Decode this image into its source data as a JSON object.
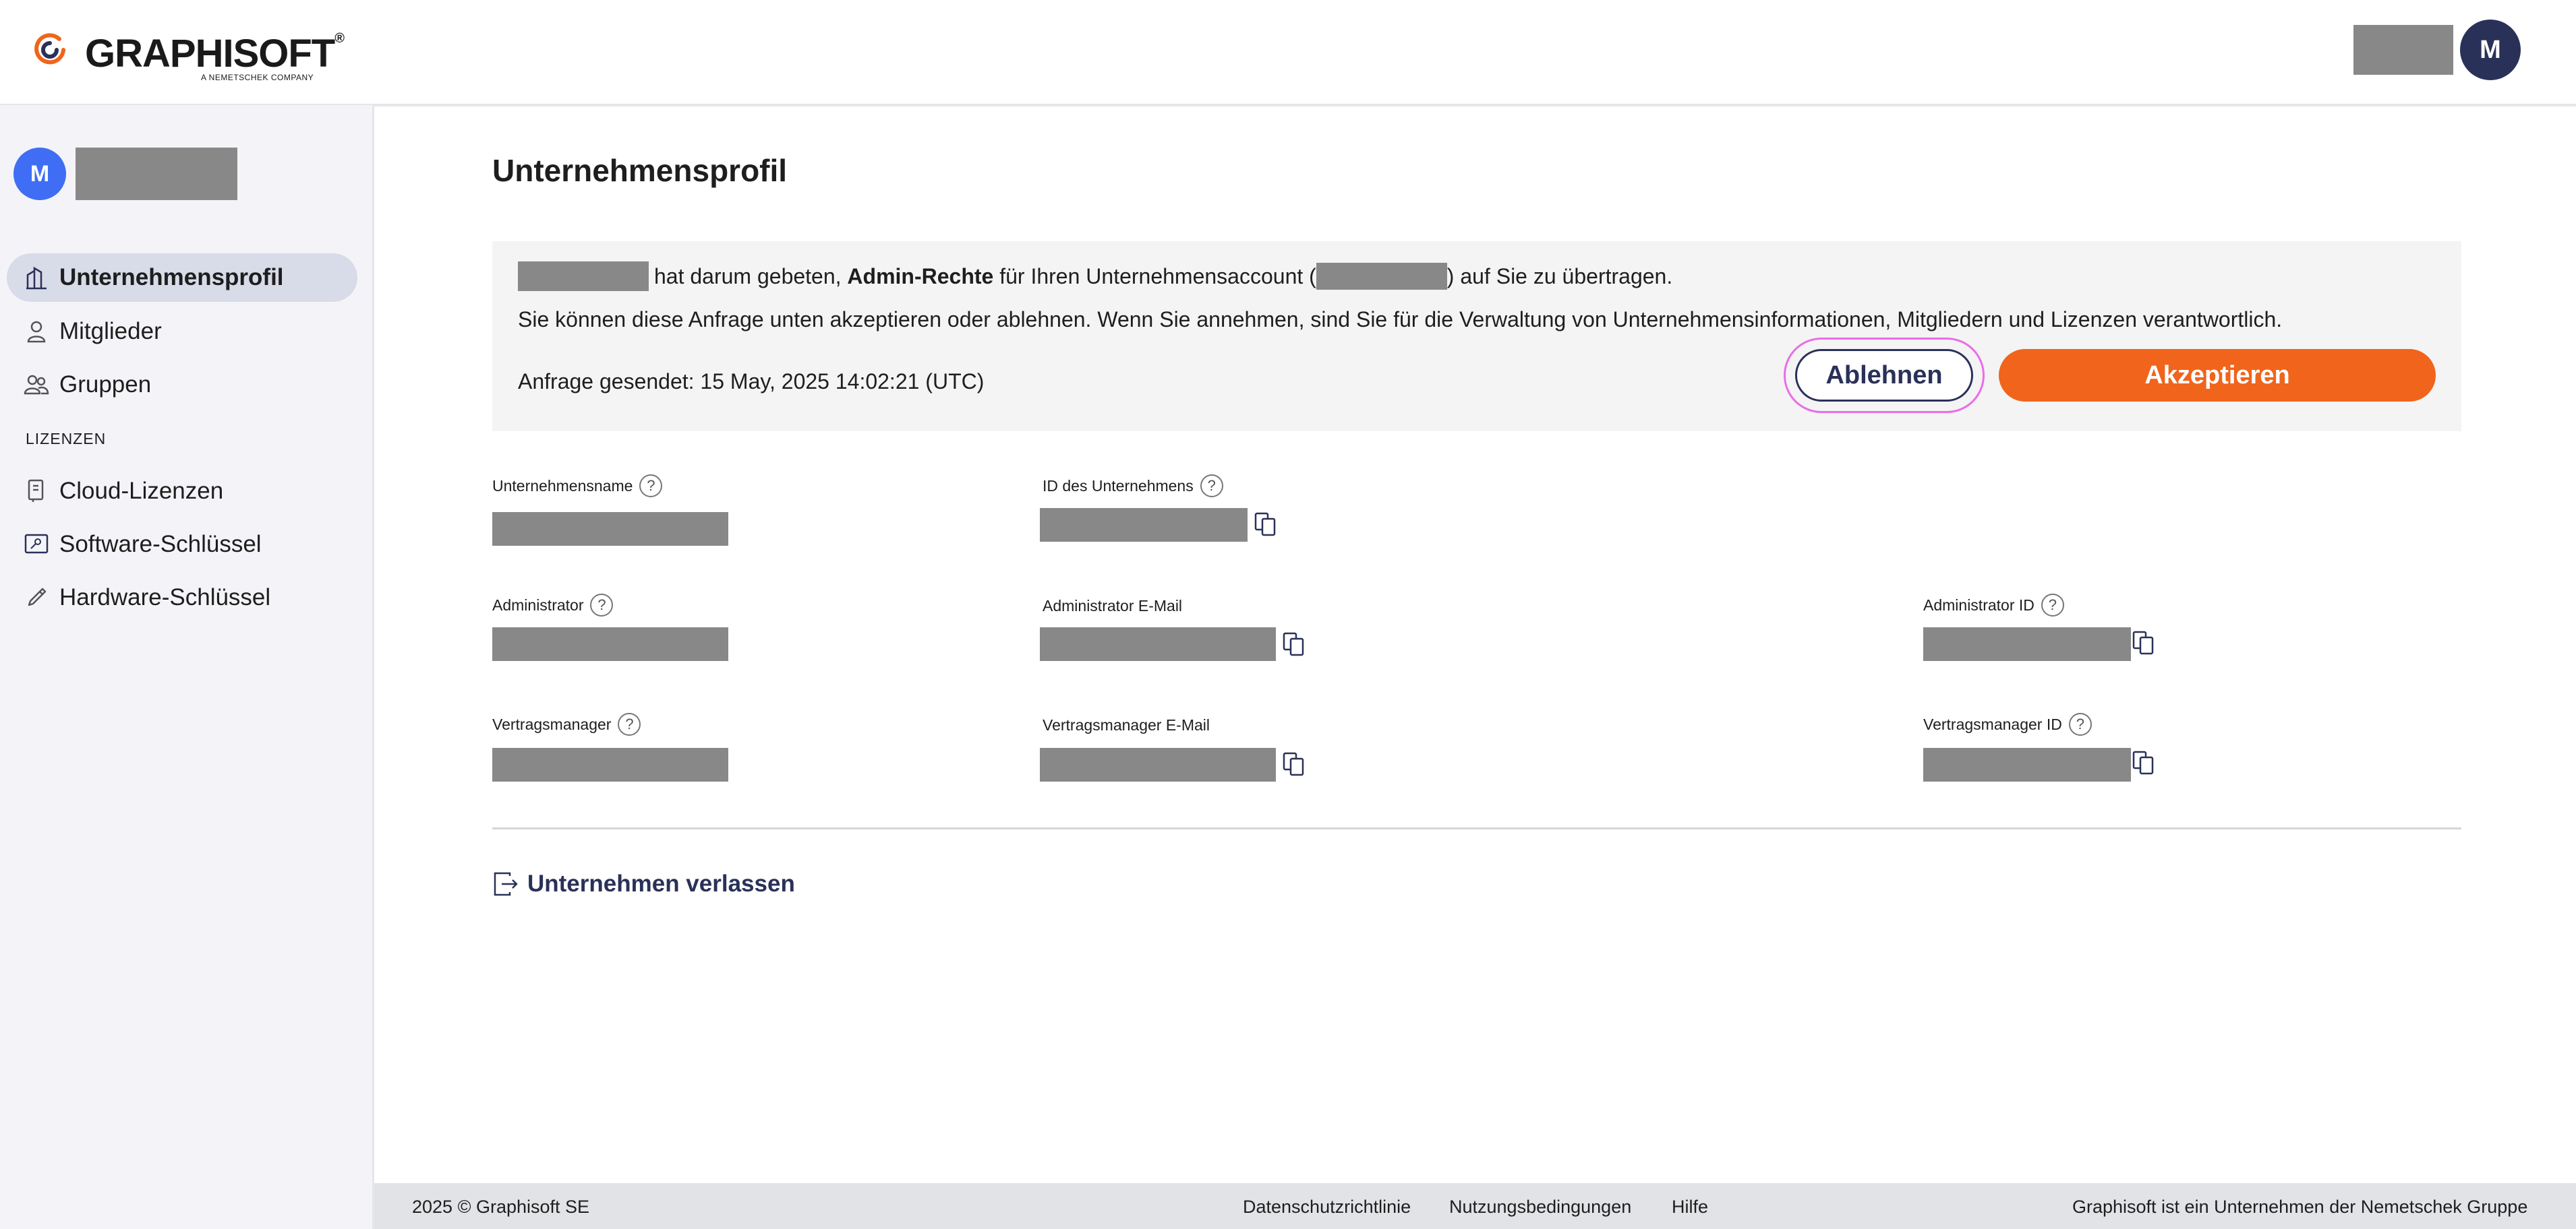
{
  "header": {
    "logo_text": "GRAPHISOFT",
    "logo_sub": "A NEMETSCHEK COMPANY",
    "avatar_initial": "M"
  },
  "sidebar": {
    "avatar_initial": "M",
    "items": [
      {
        "label": "Unternehmensprofil",
        "icon": "building-icon",
        "active": true
      },
      {
        "label": "Mitglieder",
        "icon": "person-icon"
      },
      {
        "label": "Gruppen",
        "icon": "group-icon"
      }
    ],
    "section_label": "LIZENZEN",
    "license_items": [
      {
        "label": "Cloud-Lizenzen",
        "icon": "cloud-license-icon"
      },
      {
        "label": "Software-Schlüssel",
        "icon": "software-key-icon"
      },
      {
        "label": "Hardware-Schlüssel",
        "icon": "hardware-key-icon"
      }
    ]
  },
  "main": {
    "title": "Unternehmensprofil",
    "request": {
      "text_a": "hat darum gebeten,",
      "text_bold": "Admin-Rechte",
      "text_b": "für Ihren Unternehmensaccount (",
      "text_c": ") auf Sie zu übertragen.",
      "line2": "Sie können diese Anfrage unten akzeptieren oder ablehnen. Wenn Sie annehmen, sind Sie für die Verwaltung von Unternehmensinformationen, Mitgliedern und Lizenzen verantwortlich.",
      "sent": "Anfrage gesendet: 15 May, 2025 14:02:21 (UTC)",
      "decline_label": "Ablehnen",
      "accept_label": "Akzeptieren"
    },
    "fields": {
      "company_name": "Unternehmensname",
      "company_id": "ID des Unternehmens",
      "admin": "Administrator",
      "admin_email": "Administrator E-Mail",
      "admin_id": "Administrator ID",
      "contract_manager": "Vertragsmanager",
      "contract_email": "Vertragsmanager E-Mail",
      "contract_id": "Vertragsmanager ID"
    },
    "leave_label": "Unternehmen verlassen"
  },
  "footer": {
    "copyright": "2025 © Graphisoft SE",
    "privacy": "Datenschutzrichtlinie",
    "terms": "Nutzungsbedingungen",
    "help": "Hilfe",
    "tagline": "Graphisoft ist ein Unternehmen der Nemetschek Gruppe"
  },
  "colors": {
    "accent": "#f0641b",
    "navy": "#2a3158",
    "avatar_blue": "#3f6ef5"
  }
}
